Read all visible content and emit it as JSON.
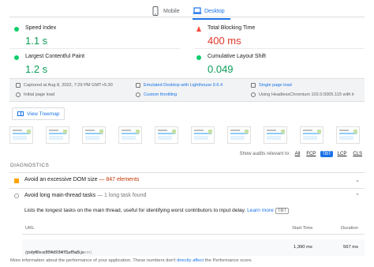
{
  "tabs": {
    "mobile": "Mobile",
    "desktop": "Desktop"
  },
  "metrics": [
    {
      "label": "Speed Index",
      "value": "1.1 s",
      "status": "good"
    },
    {
      "label": "Total Blocking Time",
      "value": "400 ms",
      "status": "poor"
    },
    {
      "label": "Largest Contentful Paint",
      "value": "1.2 s",
      "status": "good"
    },
    {
      "label": "Cumulative Layout Shift",
      "value": "0.049",
      "status": "good"
    }
  ],
  "info": {
    "captured": "Captured at Aug 8, 2022, 7:29 PM GMT+5:30",
    "initial": "Initial page load",
    "emulated": "Emulated Desktop with Lighthouse 9.6.4",
    "throttling": "Custom throttling",
    "single": "Single page load",
    "browser": "Using HeadlessChromium 102.0.5005.115 with lr"
  },
  "treemap_label": "View Treemap",
  "filter": {
    "label": "Show audits relevant to:",
    "chips": [
      "All",
      "FCP",
      "TBT",
      "LCP",
      "CLS"
    ],
    "active": "TBT"
  },
  "diagnostics_title": "DIAGNOSTICS",
  "audits": [
    {
      "title": "Avoid an excessive DOM size",
      "sep": " — ",
      "detail": "847 elements"
    },
    {
      "title": "Avoid long main-thread tasks",
      "sep": " — ",
      "detail": "1 long task found"
    }
  ],
  "description": {
    "text": "Lists the longest tasks on the main thread, useful for identifying worst contributors to input delay.",
    "link": "Learn more",
    "badge": "TBT"
  },
  "table": {
    "headers": {
      "url": "URL",
      "start": "Start Time",
      "duration": "Duration"
    },
    "rows": [
      {
        "url": "/polyfills.eff34d93475af5a5.js",
        "host": "(demo.cryptocurrencyscript.com)",
        "start": "1,390 ms",
        "duration": "567 ms"
      }
    ]
  },
  "footer": {
    "before": "More information about the performance of your application. These numbers don't",
    "link": "directly affect",
    "after": "the Performance score."
  },
  "colors": {
    "accent": "#1a73e8",
    "good": "#0c9d58",
    "poor": "#e0352b",
    "warn": "#ffa400"
  }
}
